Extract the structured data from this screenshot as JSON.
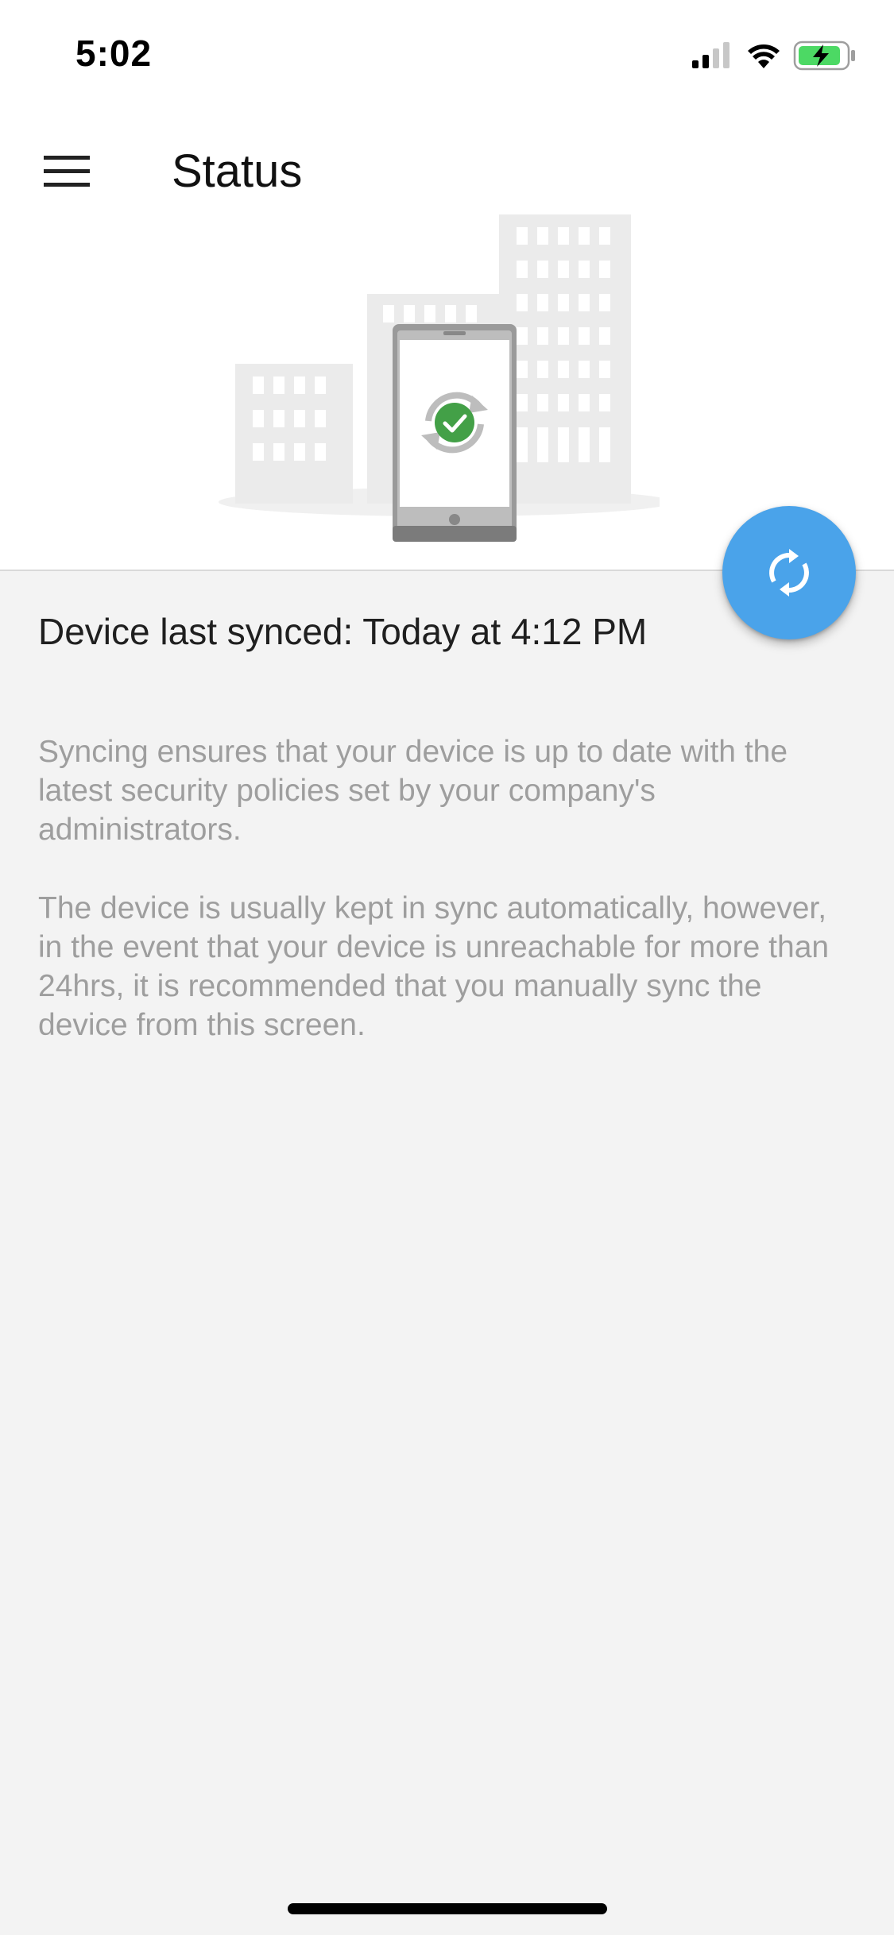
{
  "status_bar": {
    "time": "5:02",
    "signal_icon": "cellular-signal-icon",
    "wifi_icon": "wifi-icon",
    "battery_icon": "battery-charging-icon",
    "battery_color": "#4cd964"
  },
  "app_bar": {
    "menu_icon": "hamburger-menu-icon",
    "title": "Status"
  },
  "illustration": {
    "description_icon": "device-sync-success-illustration",
    "check_color": "#43a047"
  },
  "fab": {
    "icon": "sync-icon",
    "color": "#4aa3ea"
  },
  "content": {
    "last_synced": "Device last synced: Today at 4:12 PM",
    "paragraph_1": "Syncing ensures that your device is up to date with the latest security policies set by your company's administrators.",
    "paragraph_2": "The device is usually kept in sync automatically, however, in the event that your device is unreachable for more than 24hrs, it is recommended that you manually sync the device from this screen."
  }
}
